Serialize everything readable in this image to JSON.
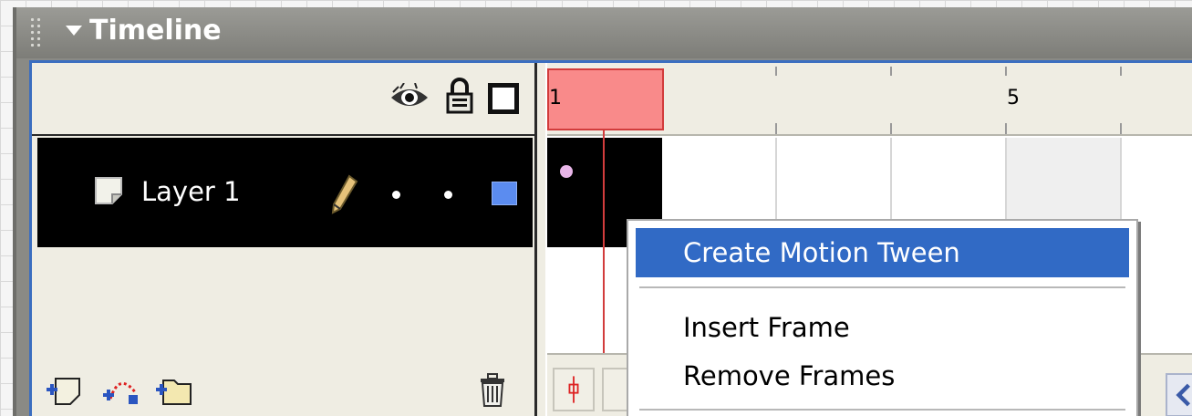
{
  "panel": {
    "title": "Timeline",
    "accent_color": "#316ac5"
  },
  "layers": {
    "header_icons": [
      "eye-icon",
      "lock-icon",
      "outline-icon"
    ],
    "items": [
      {
        "name": "Layer 1",
        "selected": true,
        "outline_color": "#5b8cf0"
      }
    ],
    "footer_icons": [
      "add-layer-icon",
      "add-motion-guide-icon",
      "add-folder-icon",
      "trash-icon"
    ]
  },
  "ruler": {
    "frame_labels": [
      "1",
      "5"
    ],
    "current_frame": 1
  },
  "context_menu": {
    "items": [
      {
        "label": "Create Motion Tween",
        "highlighted": true
      },
      {
        "label": "Insert Frame",
        "highlighted": false
      },
      {
        "label": "Remove Frames",
        "highlighted": false
      }
    ]
  }
}
